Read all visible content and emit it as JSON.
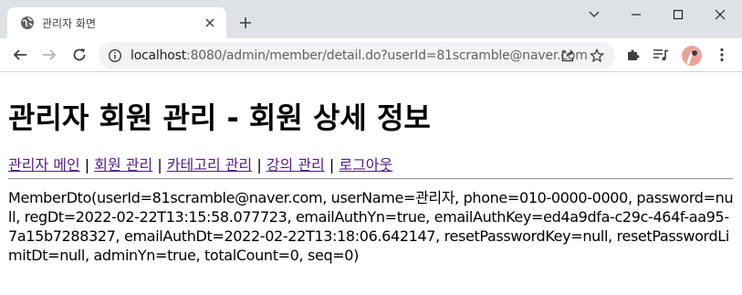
{
  "browser": {
    "tab_title": "관리자 화면",
    "url_host": "localhost",
    "url_rest": ":8080/admin/member/detail.do?userId=81scramble@naver.com",
    "icons": {
      "favicon": "globe-icon",
      "tab_close": "close-icon",
      "new_tab": "plus-icon",
      "back": "back-arrow-icon",
      "forward": "forward-arrow-icon",
      "reload": "reload-icon",
      "site_info": "info-icon",
      "share": "share-icon",
      "bookmark": "star-icon",
      "extensions": "puzzle-icon",
      "media": "media-queue-icon",
      "profile": "avatar",
      "menu": "kebab-menu-icon",
      "tab_search": "chevron-down-icon",
      "minimize": "minimize-icon",
      "maximize": "maximize-icon",
      "close_window": "window-close-icon"
    }
  },
  "page": {
    "title": "관리자 회원 관리 - 회원 상세 정보",
    "nav": [
      {
        "label": "관리자 메인"
      },
      {
        "label": "회원 관리"
      },
      {
        "label": "카테고리 관리"
      },
      {
        "label": "강의 관리"
      },
      {
        "label": "로그아웃"
      }
    ],
    "separator": "|",
    "member_dto": "MemberDto(userId=81scramble@naver.com, userName=관리자, phone=010-0000-0000, password=null, regDt=2022-02-22T13:15:58.077723, emailAuthYn=true, emailAuthKey=ed4a9dfa-c29c-464f-aa95-7a15b7288327, emailAuthDt=2022-02-22T13:18:06.642147, resetPasswordKey=null, resetPasswordLimitDt=null, adminYn=true, totalCount=0, seq=0)"
  }
}
